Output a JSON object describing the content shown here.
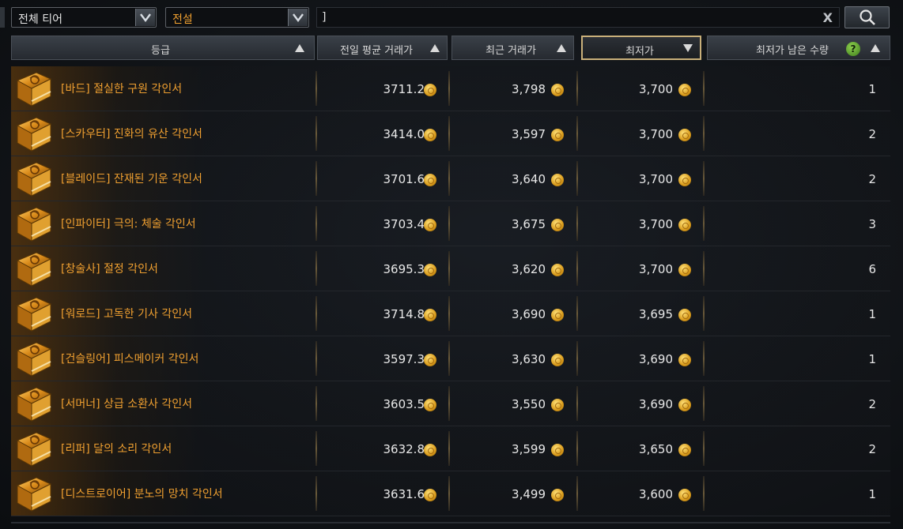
{
  "filters": {
    "tier_select": "전체 티어",
    "grade_select": "전설",
    "search_value": "]",
    "clear_label": "X"
  },
  "header": {
    "grade": "등급",
    "avg_price": "전일 평균 거래가",
    "recent_price": "최근 거래가",
    "lowest_price": "최저가",
    "lowest_remaining": "최저가 남은 수량",
    "help": "?"
  },
  "items": [
    {
      "name": "[바드] 절실한 구원 각인서",
      "avg": "3711.2",
      "recent": "3,798",
      "lowest": "3,700",
      "qty": "1"
    },
    {
      "name": "[스카우터] 진화의 유산 각인서",
      "avg": "3414.0",
      "recent": "3,597",
      "lowest": "3,700",
      "qty": "2"
    },
    {
      "name": "[블레이드] 잔재된 기운 각인서",
      "avg": "3701.6",
      "recent": "3,640",
      "lowest": "3,700",
      "qty": "2"
    },
    {
      "name": "[인파이터] 극의: 체술 각인서",
      "avg": "3703.4",
      "recent": "3,675",
      "lowest": "3,700",
      "qty": "3"
    },
    {
      "name": "[창술사] 절정 각인서",
      "avg": "3695.3",
      "recent": "3,620",
      "lowest": "3,700",
      "qty": "6"
    },
    {
      "name": "[워로드] 고독한 기사 각인서",
      "avg": "3714.8",
      "recent": "3,690",
      "lowest": "3,695",
      "qty": "1"
    },
    {
      "name": "[건슬링어] 피스메이커 각인서",
      "avg": "3597.3",
      "recent": "3,630",
      "lowest": "3,690",
      "qty": "1"
    },
    {
      "name": "[서머너] 상급 소환사 각인서",
      "avg": "3603.5",
      "recent": "3,550",
      "lowest": "3,690",
      "qty": "2"
    },
    {
      "name": "[리퍼] 달의 소리 각인서",
      "avg": "3632.8",
      "recent": "3,599",
      "lowest": "3,650",
      "qty": "2"
    },
    {
      "name": "[디스트로이어] 분노의 망치 각인서",
      "avg": "3631.6",
      "recent": "3,499",
      "lowest": "3,600",
      "qty": "1"
    }
  ],
  "icons": {
    "item": "engraving-book-icon",
    "currency": "gold-coin-icon",
    "search": "search-icon",
    "dropdown": "chevron-down-icon"
  },
  "colors": {
    "item_name": "#f0a030",
    "active_sort_border": "#c9b07a",
    "gold": "#e8b23a"
  }
}
